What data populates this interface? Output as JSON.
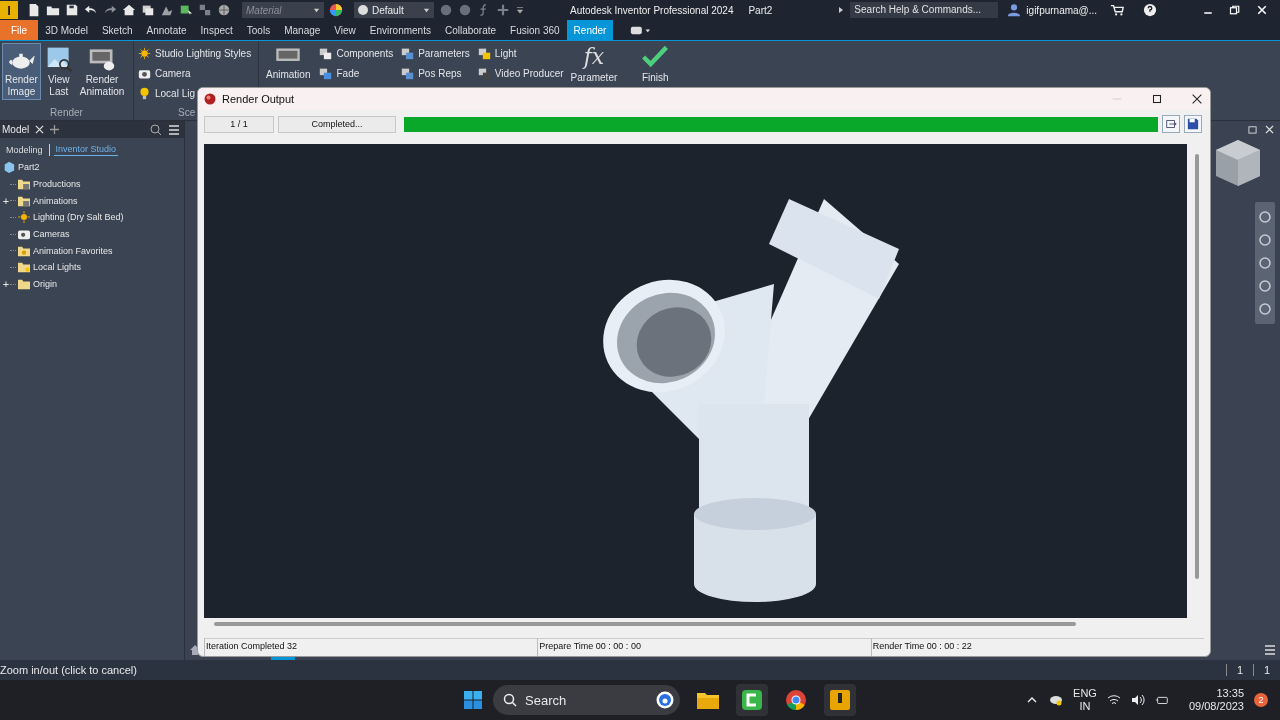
{
  "app": {
    "logo": "I",
    "material_placeholder": "Material",
    "appearance": "Default",
    "title": "Autodesk Inventor Professional 2024",
    "document": "Part2",
    "search_placeholder": "Search Help & Commands...",
    "user": "igifpurnama@..."
  },
  "tabs": [
    {
      "label": "File",
      "kind": "file",
      "selected": false
    },
    {
      "label": "3D Model",
      "kind": "tab",
      "selected": false
    },
    {
      "label": "Sketch",
      "kind": "tab",
      "selected": false
    },
    {
      "label": "Annotate",
      "kind": "tab",
      "selected": false
    },
    {
      "label": "Inspect",
      "kind": "tab",
      "selected": false
    },
    {
      "label": "Tools",
      "kind": "tab",
      "selected": false
    },
    {
      "label": "Manage",
      "kind": "tab",
      "selected": false
    },
    {
      "label": "View",
      "kind": "tab",
      "selected": false
    },
    {
      "label": "Environments",
      "kind": "tab",
      "selected": false
    },
    {
      "label": "Collaborate",
      "kind": "tab",
      "selected": false
    },
    {
      "label": "Fusion 360",
      "kind": "tab",
      "selected": false
    },
    {
      "label": "Render",
      "kind": "tab",
      "selected": true
    }
  ],
  "ribbon": {
    "render_panel": {
      "label": "Render",
      "buttons": [
        {
          "label": "Render\nImage",
          "kind": "teapot",
          "selected": true
        },
        {
          "label": "View\nLast",
          "kind": "picture-search",
          "selected": false
        },
        {
          "label": "Render\nAnimation",
          "kind": "film-teapot",
          "selected": false
        }
      ]
    },
    "scene_panel": {
      "label": "Sce",
      "items": [
        {
          "label": "Studio Lighting Styles",
          "kind": "sun"
        },
        {
          "label": "Camera",
          "kind": "camera"
        },
        {
          "label": "Local Lig",
          "kind": "bulb"
        }
      ]
    },
    "animation": {
      "label": "Animation"
    },
    "columns": [
      [
        {
          "label": "Components",
          "kind": "component"
        },
        {
          "label": "Fade",
          "kind": "fade"
        }
      ],
      [
        {
          "label": "Parameters",
          "kind": "params"
        },
        {
          "label": "Pos Reps",
          "kind": "posreps"
        }
      ],
      [
        {
          "label": "Light",
          "kind": "light"
        },
        {
          "label": "Video Producer",
          "kind": "clapper"
        }
      ]
    ],
    "parameter": {
      "symbol": "fx",
      "label": "Parameter"
    },
    "finish": {
      "label": "Finish"
    }
  },
  "browser": {
    "tab": "Model",
    "modes": [
      {
        "label": "Modeling",
        "selected": false
      },
      {
        "label": "Inventor Studio",
        "selected": true
      }
    ],
    "tree": [
      {
        "label": "Part2",
        "kind": "part",
        "children": [
          {
            "label": "Productions",
            "kind": "folder-doc"
          },
          {
            "label": "Animations",
            "kind": "folder-grid",
            "toggle": "+"
          },
          {
            "label": "Lighting (Dry Salt Bed)",
            "kind": "sun"
          },
          {
            "label": "Cameras",
            "kind": "camera"
          },
          {
            "label": "Animation Favorites",
            "kind": "folder-star"
          },
          {
            "label": "Local Lights",
            "kind": "folder-bulb"
          },
          {
            "label": "Origin",
            "kind": "folder",
            "toggle": "+"
          }
        ]
      }
    ]
  },
  "dialog": {
    "title": "Render Output",
    "counter": "1 / 1",
    "status": "Completed...",
    "progress": {
      "level": 1
    },
    "footer": [
      "Iteration Completed  32",
      "Prepare Time  00 : 00 : 00",
      "Render Time  00 : 00 : 22"
    ]
  },
  "status_bar": {
    "message": "Zoom in/out (click to cancel)",
    "cells": [
      "1",
      "1"
    ]
  },
  "taskbar": {
    "search": "Search",
    "language": [
      "ENG",
      "IN"
    ],
    "time": "13:35",
    "date": "09/08/2023",
    "notifications": "2"
  }
}
